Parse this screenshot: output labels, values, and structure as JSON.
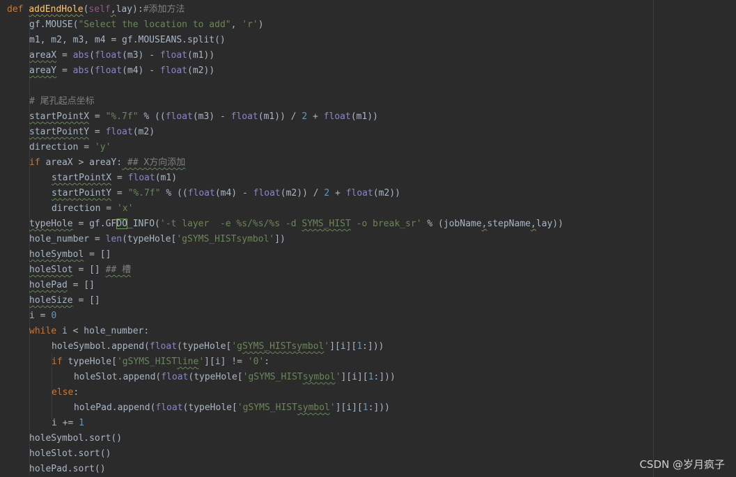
{
  "code": {
    "l1": {
      "def": "def ",
      "name": "addEndHole",
      "open": "(",
      "self": "self",
      "comma": ",",
      "arg": "lay",
      "close": "):",
      "comment": "#添加方法"
    },
    "l2": {
      "a": "gf.MOUSE(",
      "s1": "\"Select the location to add\"",
      "b": ", ",
      "s2": "'r'",
      "c": ")"
    },
    "l3": {
      "a": "m1, m2, m3, m4 = gf.MOUSEANS.split()"
    },
    "l4": {
      "var": "areaX",
      "a": " = ",
      "abs": "abs",
      "b": "(",
      "f1": "float",
      "c": "(m3) - ",
      "f2": "float",
      "d": "(m1))"
    },
    "l5": {
      "var": "areaY",
      "a": " = ",
      "abs": "abs",
      "b": "(",
      "f1": "float",
      "c": "(m4) - ",
      "f2": "float",
      "d": "(m2))"
    },
    "l7": {
      "comment": "# 尾孔起点坐标"
    },
    "l8": {
      "var": "startPointX",
      "a": " = ",
      "s": "\"%.7f\"",
      "b": " % ((",
      "f1": "float",
      "c": "(m3) - ",
      "f2": "float",
      "d": "(m1)) / ",
      "n": "2",
      "e": " + ",
      "f3": "float",
      "g": "(m1))"
    },
    "l9": {
      "var": "startPointY",
      "a": " = ",
      "f": "float",
      "b": "(m2)"
    },
    "l10": {
      "a": "direction = ",
      "s": "'y'"
    },
    "l11": {
      "kw": "if",
      "a": " areaX > areaY:",
      "comment": " ## X方向添加"
    },
    "l12": {
      "var": "startPointX",
      "a": " = ",
      "f": "float",
      "b": "(m1)"
    },
    "l13": {
      "var": "startPointY",
      "a": " = ",
      "s": "\"%.7f\"",
      "b": " % ((",
      "f1": "float",
      "c": "(m4) - ",
      "f2": "float",
      "d": "(m2)) / ",
      "n": "2",
      "e": " + ",
      "f3": "float",
      "g": "(m2))"
    },
    "l14": {
      "a": "direction = ",
      "s": "'x'"
    },
    "l15": {
      "var": "typeHole",
      "a": " = gf.GF",
      "cur": "DO",
      "b": "_INFO(",
      "s1": "'-t layer  -e %s/%s/%s -d ",
      "s2": "SYMS_HIST",
      "s3": " -o break_sr'",
      "c": " % (jobName",
      "c2": ",",
      "d": "stepName",
      "d2": ",",
      "e": "lay))"
    },
    "l16": {
      "a": "hole_number = ",
      "f": "len",
      "b": "(typeHole[",
      "s": "'gSYMS_HISTsymbol'",
      "c": "])"
    },
    "l17": {
      "var": "holeSymbol",
      "a": " = []"
    },
    "l18": {
      "var": "holeSlot",
      "a": " = [] ",
      "comment": "## 槽"
    },
    "l19": {
      "var": "holePad",
      "a": " = []"
    },
    "l20": {
      "var": "holeSize",
      "a": " = []"
    },
    "l21": {
      "a": "i = ",
      "n": "0"
    },
    "l22": {
      "kw": "while",
      "a": " i < hole_number:"
    },
    "l23": {
      "a": "holeSymbol.append(",
      "f": "float",
      "b": "(typeHole[",
      "s1": "'g",
      "s2": "SYMS_HISTsymbol",
      "s3": "'",
      "c": "][i][",
      "n": "1",
      "d": ":]))"
    },
    "l24": {
      "kw": "if",
      "a": " typeHole[",
      "s1": "'gSYMS_HIST",
      "s2": "line",
      "s3": "'",
      "b": "][i] != ",
      "s": "'0'",
      "c": ":"
    },
    "l25": {
      "a": "holeSlot.append(",
      "f": "float",
      "b": "(typeHole[",
      "s1": "'gSYMS_HIST",
      "s2": "symbol",
      "s3": "'",
      "c": "][i][",
      "n": "1",
      "d": ":]))"
    },
    "l26": {
      "kw": "else",
      "a": ":"
    },
    "l27": {
      "a": "holePad.append(",
      "f": "float",
      "b": "(typeHole[",
      "s1": "'gSYMS_HIST",
      "s2": "symbol",
      "s3": "'",
      "c": "][i][",
      "n": "1",
      "d": ":]))"
    },
    "l28": {
      "a": "i += ",
      "n": "1"
    },
    "l29": {
      "a": "holeSymbol.sort()"
    },
    "l30": {
      "a": "holeSlot.sort()"
    },
    "l31": {
      "a": "holePad.sort()"
    }
  },
  "watermark": "CSDN @岁月疯子",
  "colors": {
    "background": "#2b2b2b",
    "keyword": "#cc7832",
    "string": "#6a8759",
    "number": "#6897bb",
    "function": "#ffc66d",
    "builtin": "#8888c6",
    "comment": "#808080"
  }
}
